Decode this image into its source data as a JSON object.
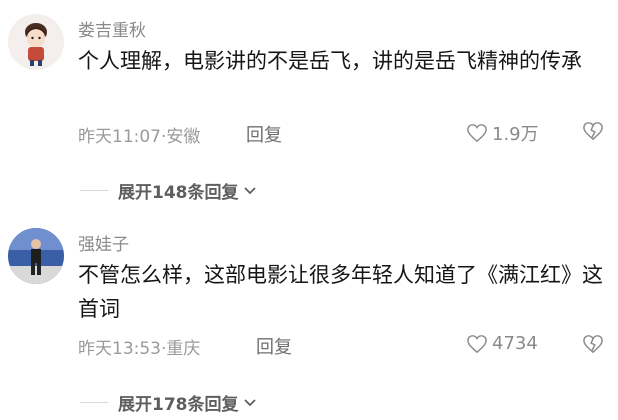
{
  "comments": [
    {
      "username": "娄吉重秋",
      "text": "个人理解，电影讲的不是岳飞，讲的是岳飞精神的传承",
      "meta": "昨天11:07·安徽",
      "reply_label": "回复",
      "likes": "1.9万",
      "expand_label": "展开148条回复"
    },
    {
      "username": "强娃子",
      "text": "不管怎么样，这部电影让很多年轻人知道了《满江红》这首词",
      "meta": "昨天13:53·重庆",
      "reply_label": "回复",
      "likes": "4734",
      "expand_label": "展开178条回复"
    }
  ],
  "colors": {
    "username": "#8a8a8a",
    "body": "#161616",
    "meta": "#9a9a9a",
    "icon": "#8a8a8a"
  },
  "icons": [
    "heart-icon",
    "dislike-heart-icon",
    "chevron-down-icon"
  ]
}
